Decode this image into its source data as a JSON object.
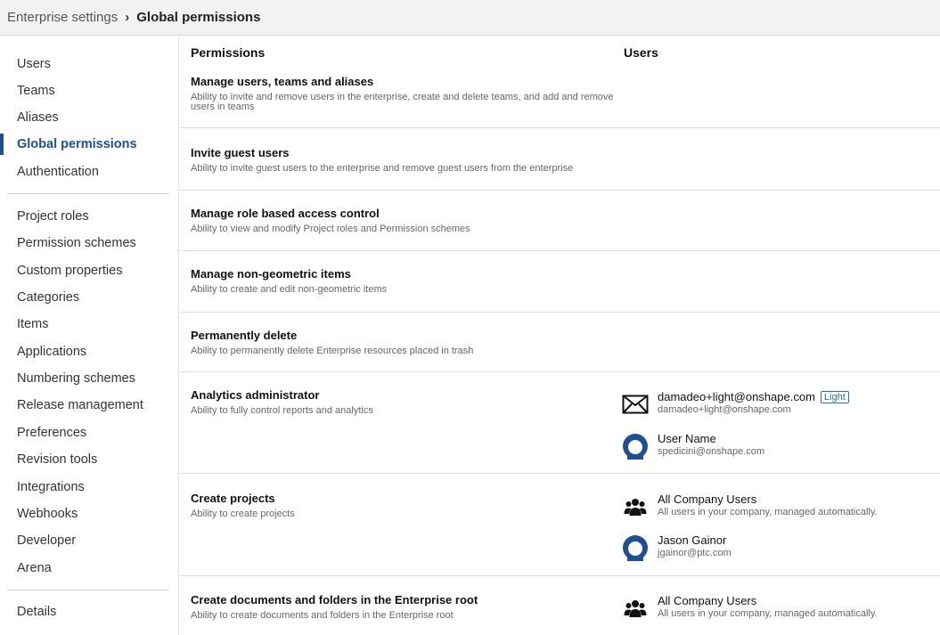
{
  "breadcrumb": {
    "parent": "Enterprise settings",
    "current": "Global permissions"
  },
  "sidebar": {
    "group1": [
      "Users",
      "Teams",
      "Aliases",
      "Global permissions",
      "Authentication"
    ],
    "group2": [
      "Project roles",
      "Permission schemes",
      "Custom properties",
      "Categories",
      "Items",
      "Applications",
      "Numbering schemes",
      "Release management",
      "Preferences",
      "Revision tools",
      "Integrations",
      "Webhooks",
      "Developer",
      "Arena"
    ],
    "group3": [
      "Details"
    ],
    "active": "Global permissions"
  },
  "table": {
    "headers": {
      "permissions": "Permissions",
      "users": "Users"
    },
    "rows": [
      {
        "title": "Manage users, teams and aliases",
        "desc": "Ability to invite and remove users in the enterprise, create and delete teams, and add and remove users in teams",
        "users": []
      },
      {
        "title": "Invite guest users",
        "desc": "Ability to invite guest users to the enterprise and remove guest users from the enterprise",
        "users": []
      },
      {
        "title": "Manage role based access control",
        "desc": "Ability to view and modify Project roles and Permission schemes",
        "users": []
      },
      {
        "title": "Manage non-geometric items",
        "desc": "Ability to create and edit non-geometric items",
        "users": []
      },
      {
        "title": "Permanently delete",
        "desc": "Ability to permanently delete Enterprise resources placed in trash",
        "users": []
      },
      {
        "title": "Analytics administrator",
        "desc": "Ability to fully control reports and analytics",
        "users": [
          {
            "icon": "envelope-icon",
            "name": "damadeo+light@onshape.com",
            "badge": "Light",
            "sub": "damadeo+light@onshape.com"
          },
          {
            "icon": "user-avatar-icon",
            "name": "User Name",
            "sub": "spedicini@onshape.com"
          }
        ]
      },
      {
        "title": "Create projects",
        "desc": "Ability to create projects",
        "users": [
          {
            "icon": "group-icon",
            "name": "All Company Users",
            "sub": "All users in your company, managed automatically."
          },
          {
            "icon": "user-avatar-icon",
            "name": "Jason Gainor",
            "sub": "jgainor@ptc.com"
          }
        ]
      },
      {
        "title": "Create documents and folders in the Enterprise root",
        "desc": "Ability to create documents and folders in the Enterprise root",
        "users": [
          {
            "icon": "group-icon",
            "name": "All Company Users",
            "sub": "All users in your company, managed automatically."
          }
        ]
      }
    ]
  },
  "colors": {
    "accent": "#1f4f8f",
    "badge": "#2b6cb0"
  }
}
